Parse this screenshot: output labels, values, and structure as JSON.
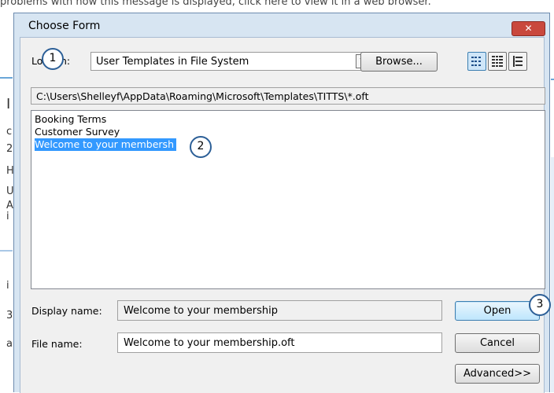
{
  "background": {
    "banner_text": "problems with how this message is displayed, click here to view it in a web browser.",
    "left_fragments": [
      "I",
      "c",
      "2",
      "H",
      "U",
      "i",
      "A",
      "i",
      "3",
      "a"
    ]
  },
  "dialog": {
    "title": "Choose Form",
    "close_label": "✕",
    "look_in_label": "Look In:",
    "look_in_value": "User Templates in File System",
    "browse_label": "Browse...",
    "view_icons": [
      "list-view-icon",
      "details-view-icon",
      "properties-view-icon"
    ],
    "path": "C:\\Users\\Shelleyf\\AppData\\Roaming\\Microsoft\\Templates\\TITTS\\*.oft",
    "items": [
      {
        "label": "Booking Terms",
        "selected": false
      },
      {
        "label": "Customer Survey",
        "selected": false
      },
      {
        "label": "Welcome to your membersh",
        "selected": true
      }
    ],
    "display_name_label": "Display name:",
    "display_name_value": "Welcome to your membership",
    "file_name_label": "File name:",
    "file_name_value": "Welcome to your membership.oft",
    "open_label": "Open",
    "cancel_label": "Cancel",
    "advanced_label": "Advanced>>"
  },
  "callouts": [
    "1",
    "2",
    "3"
  ],
  "colors": {
    "dialog_frame": "#d7e5f2",
    "selection": "#3399ff",
    "close_button": "#c9483d",
    "callout_border": "#2c5f97"
  }
}
